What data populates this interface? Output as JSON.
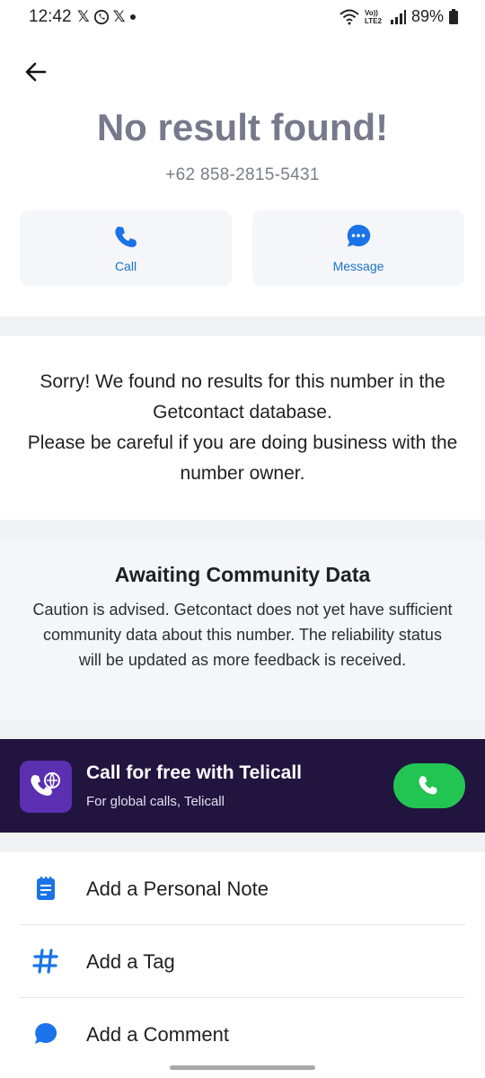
{
  "status_bar": {
    "time": "12:42",
    "left_icons": [
      "x-icon",
      "whatsapp-icon",
      "x-icon",
      "dot-icon"
    ],
    "network_label": "Vo)) LTE2",
    "battery": "89%"
  },
  "header": {
    "title": "No result found!",
    "phone_number": "+62 858-2815-5431"
  },
  "actions": {
    "call_label": "Call",
    "message_label": "Message"
  },
  "notice": {
    "line1": "Sorry! We found no results for this number in the Getcontact database.",
    "line2": "Please be careful if you are doing business with the number owner."
  },
  "community": {
    "title": "Awaiting Community Data",
    "body": "Caution is advised. Getcontact does not yet have sufficient community data about this number. The reliability status will be updated as more feedback is received."
  },
  "promo": {
    "title": "Call for free with Telicall",
    "subtitle": "For global calls, Telicall"
  },
  "menu": [
    {
      "label": "Add a Personal Note",
      "icon": "note-icon"
    },
    {
      "label": "Add a Tag",
      "icon": "hashtag-icon"
    },
    {
      "label": "Add a Comment",
      "icon": "comment-icon"
    }
  ],
  "colors": {
    "accent_blue": "#1a73e8",
    "title_gray": "#777a8c",
    "promo_bg": "#21143f",
    "promo_call_green": "#23c552"
  }
}
